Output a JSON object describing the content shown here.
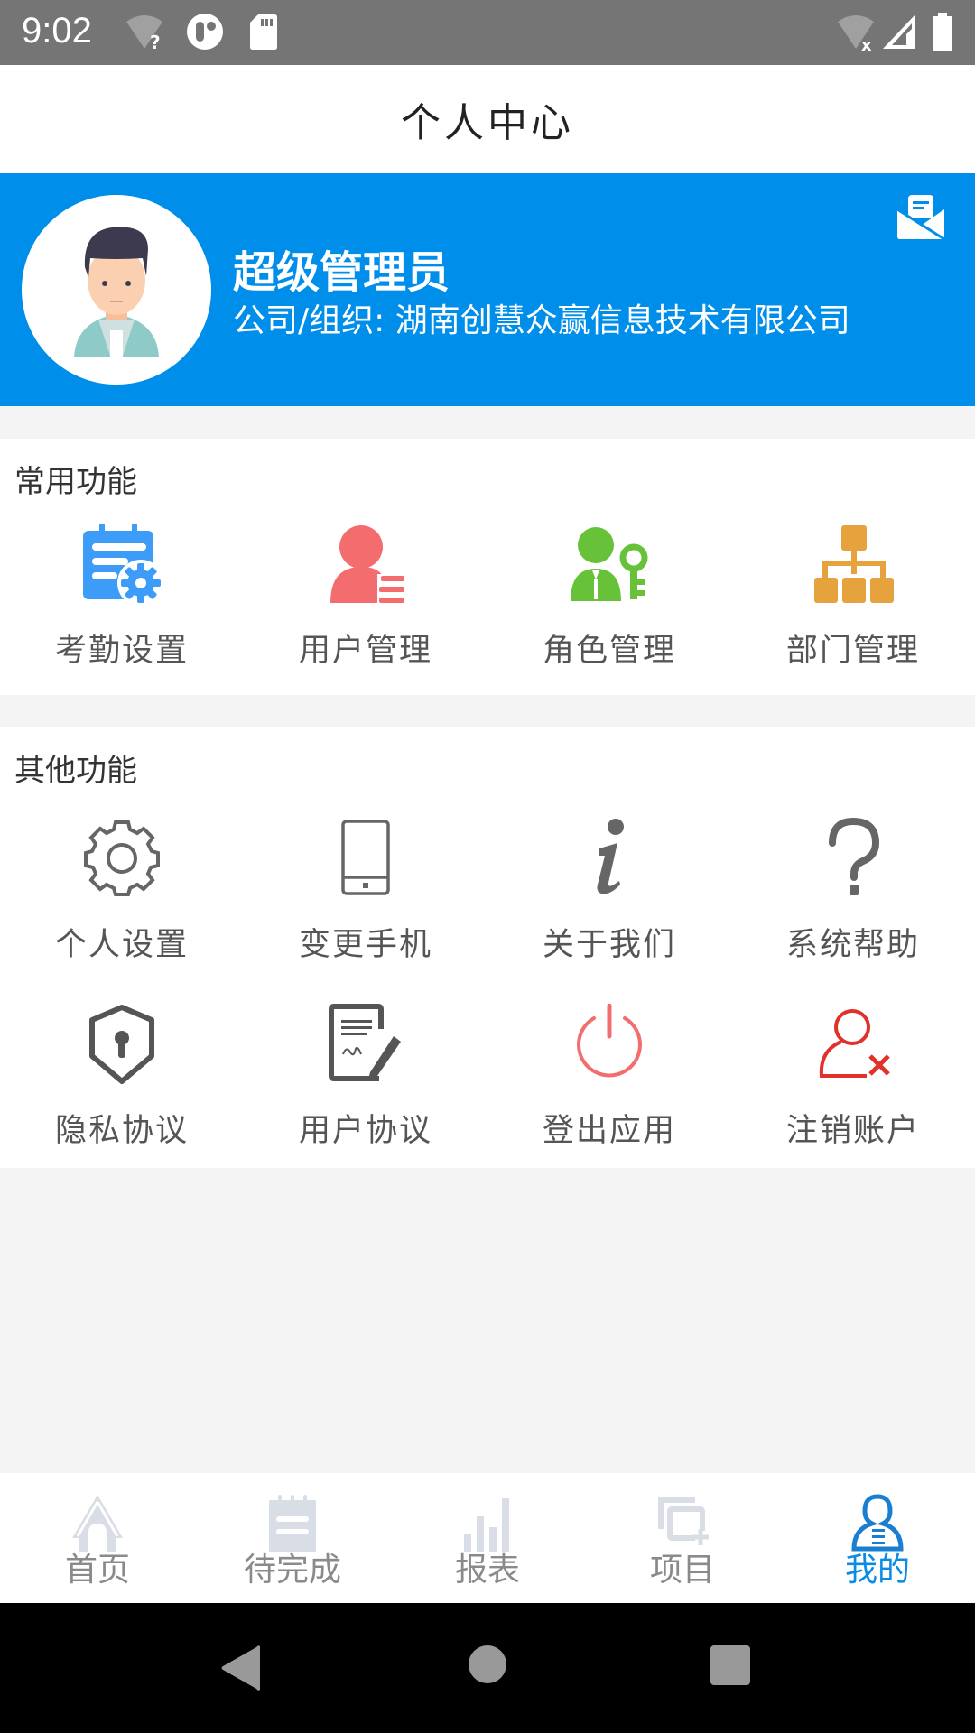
{
  "status_bar": {
    "time": "9:02",
    "left_icons": [
      "wifi-unknown-icon",
      "app-notification-icon",
      "sd-card-icon"
    ],
    "right_icons": [
      "wifi-off-icon",
      "cell-signal-icon",
      "battery-icon"
    ]
  },
  "header": {
    "title": "个人中心"
  },
  "profile": {
    "name": "超级管理员",
    "org_line": "公司/组织: 湖南创慧众赢信息技术有限公司",
    "message_icon": "envelope-open-icon",
    "banner_color": "#008EEB"
  },
  "common_functions": {
    "title": "常用功能",
    "items": [
      {
        "label": "考勤设置",
        "icon": "attendance-settings-icon",
        "color": "#3e9cf9"
      },
      {
        "label": "用户管理",
        "icon": "user-management-icon",
        "color": "#f36d6e"
      },
      {
        "label": "角色管理",
        "icon": "role-key-icon",
        "color": "#67c23a"
      },
      {
        "label": "部门管理",
        "icon": "org-chart-icon",
        "color": "#e6a23c"
      }
    ]
  },
  "other_functions": {
    "title": "其他功能",
    "items": [
      {
        "label": "个人设置",
        "icon": "gear-icon",
        "color": "#666666"
      },
      {
        "label": "变更手机",
        "icon": "phone-icon",
        "color": "#666666"
      },
      {
        "label": "关于我们",
        "icon": "info-icon",
        "color": "#666666"
      },
      {
        "label": "系统帮助",
        "icon": "help-question-icon",
        "color": "#666666"
      },
      {
        "label": "隐私协议",
        "icon": "privacy-shield-icon",
        "color": "#666666"
      },
      {
        "label": "用户协议",
        "icon": "agreement-sign-icon",
        "color": "#666666"
      },
      {
        "label": "登出应用",
        "icon": "power-icon",
        "color": "#f36d6e"
      },
      {
        "label": "注销账户",
        "icon": "remove-user-icon",
        "color": "#e0312a"
      }
    ]
  },
  "bottom_nav": {
    "active_index": 4,
    "active_color": "#0A8BE6",
    "tabs": [
      {
        "label": "首页",
        "icon": "home-icon"
      },
      {
        "label": "待完成",
        "icon": "todo-notepad-icon"
      },
      {
        "label": "报表",
        "icon": "report-bars-icon"
      },
      {
        "label": "项目",
        "icon": "project-add-icon"
      },
      {
        "label": "我的",
        "icon": "profile-person-icon"
      }
    ]
  },
  "system_nav": {
    "keys": [
      "back-icon",
      "home-circle-icon",
      "recents-square-icon"
    ]
  }
}
